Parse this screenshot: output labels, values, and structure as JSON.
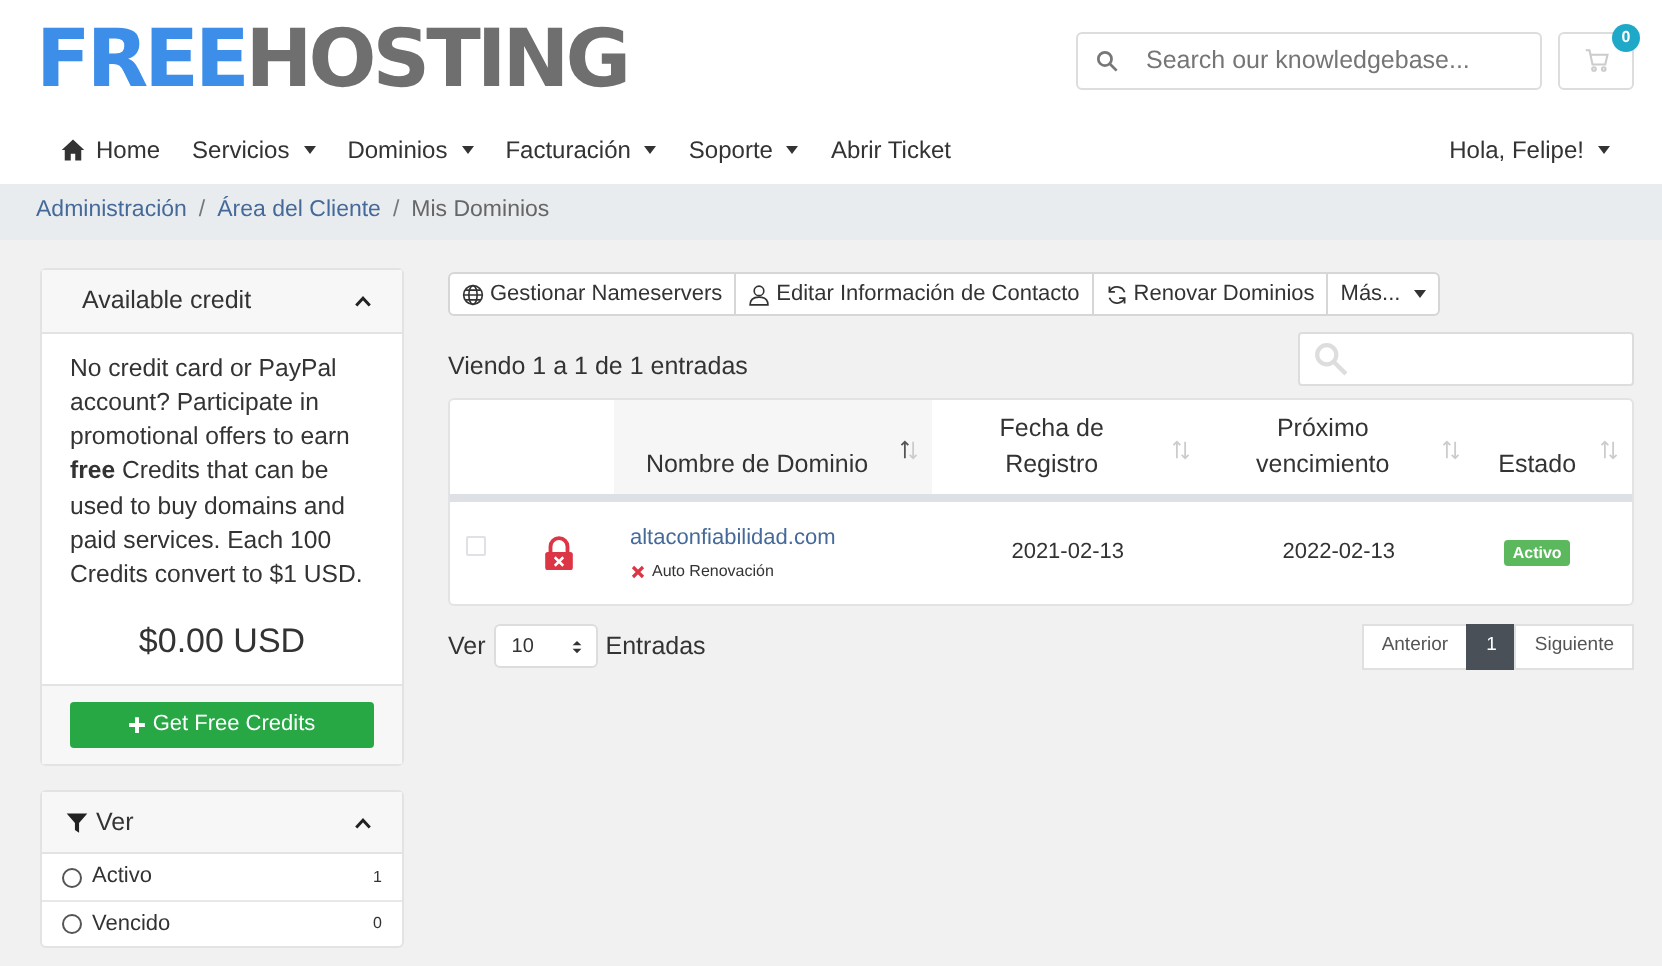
{
  "logo": {
    "first": "FREE",
    "second": "HOSTING"
  },
  "search": {
    "placeholder": "Search our knowledgebase..."
  },
  "cart": {
    "count": "0"
  },
  "nav": [
    {
      "label": "Home",
      "dropdown": false
    },
    {
      "label": "Servicios",
      "dropdown": true
    },
    {
      "label": "Dominios",
      "dropdown": true
    },
    {
      "label": "Facturación",
      "dropdown": true
    },
    {
      "label": "Soporte",
      "dropdown": true
    },
    {
      "label": "Abrir Ticket",
      "dropdown": false
    }
  ],
  "user_menu": {
    "label": "Hola, Felipe!",
    "dropdown": true
  },
  "breadcrumb": [
    {
      "label": "Administración",
      "current": false
    },
    {
      "separator": "/",
      "label": "Área del Cliente",
      "current": false
    },
    {
      "separator": "/",
      "label": "Mis Dominios",
      "current": true
    }
  ],
  "credit_card": {
    "title": "Available credit",
    "expanded": true,
    "text": "No credit card or PayPal account? Participate in promotional offers to earn **free** Credits that can be used to buy domains and paid services. Each 100 Credits convert to $1 USD.",
    "amount": "$0.00 USD",
    "button": "Get Free Credits"
  },
  "filter_card": {
    "title": "Ver",
    "expanded": true,
    "options": [
      {
        "label": "Activo",
        "count": "1",
        "checked": false
      },
      {
        "label": "Vencido",
        "count": "0",
        "checked": false
      }
    ]
  },
  "actions": [
    {
      "label": "Gestionar Nameservers",
      "dropdown": false
    },
    {
      "label": "Editar Información de Contacto",
      "dropdown": false
    },
    {
      "label": "Renovar Dominios",
      "dropdown": false
    },
    {
      "label": "Más...",
      "dropdown": true
    }
  ],
  "summary": "Viendo 1 a 1 de 1 entradas",
  "table": {
    "columns": [
      {
        "label": "Nombre de Dominio",
        "sorted": true
      },
      {
        "label": "Fecha de Registro",
        "sorted": false
      },
      {
        "label": "Próximo vencimiento",
        "sorted": false
      },
      {
        "label": "Estado",
        "sorted": false
      }
    ],
    "rows": [
      {
        "checked": false,
        "locked": false,
        "domain": "altaconfiabilidad.com",
        "auto_renew": {
          "label": "Auto Renovación",
          "on": false
        },
        "registered": "2021-02-13",
        "expires": "2022-02-13",
        "status": {
          "label": "Activo",
          "color": "#5cb85c"
        }
      }
    ]
  },
  "page_length": {
    "prefix": "Ver",
    "value": "10",
    "suffix": "Entradas"
  },
  "pagination": [
    {
      "label": "Anterior",
      "selected": false
    },
    {
      "label": "1",
      "selected": true
    },
    {
      "label": "Siguiente",
      "selected": false
    }
  ]
}
